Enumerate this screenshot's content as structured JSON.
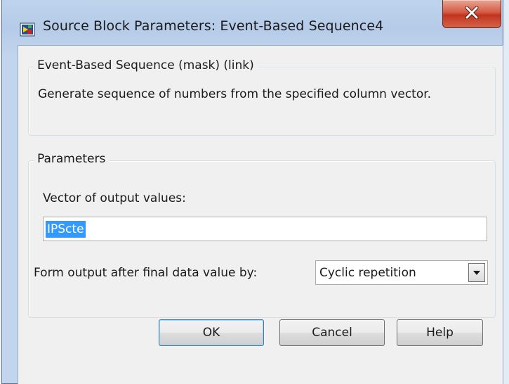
{
  "window": {
    "title": "Source Block Parameters: Event-Based Sequence4",
    "icon": "simulink-block-icon",
    "close_icon": "close-icon"
  },
  "description_group": {
    "legend": "Event-Based Sequence (mask) (link)",
    "text": "Generate sequence of numbers from the specified column vector."
  },
  "parameters_group": {
    "legend": "Parameters",
    "vector_label": "Vector of output values:",
    "vector_value": "IPScte",
    "form_label": "Form output after final data value by:",
    "form_value": "Cyclic repetition"
  },
  "buttons": {
    "ok": "OK",
    "cancel": "Cancel",
    "help": "Help"
  }
}
